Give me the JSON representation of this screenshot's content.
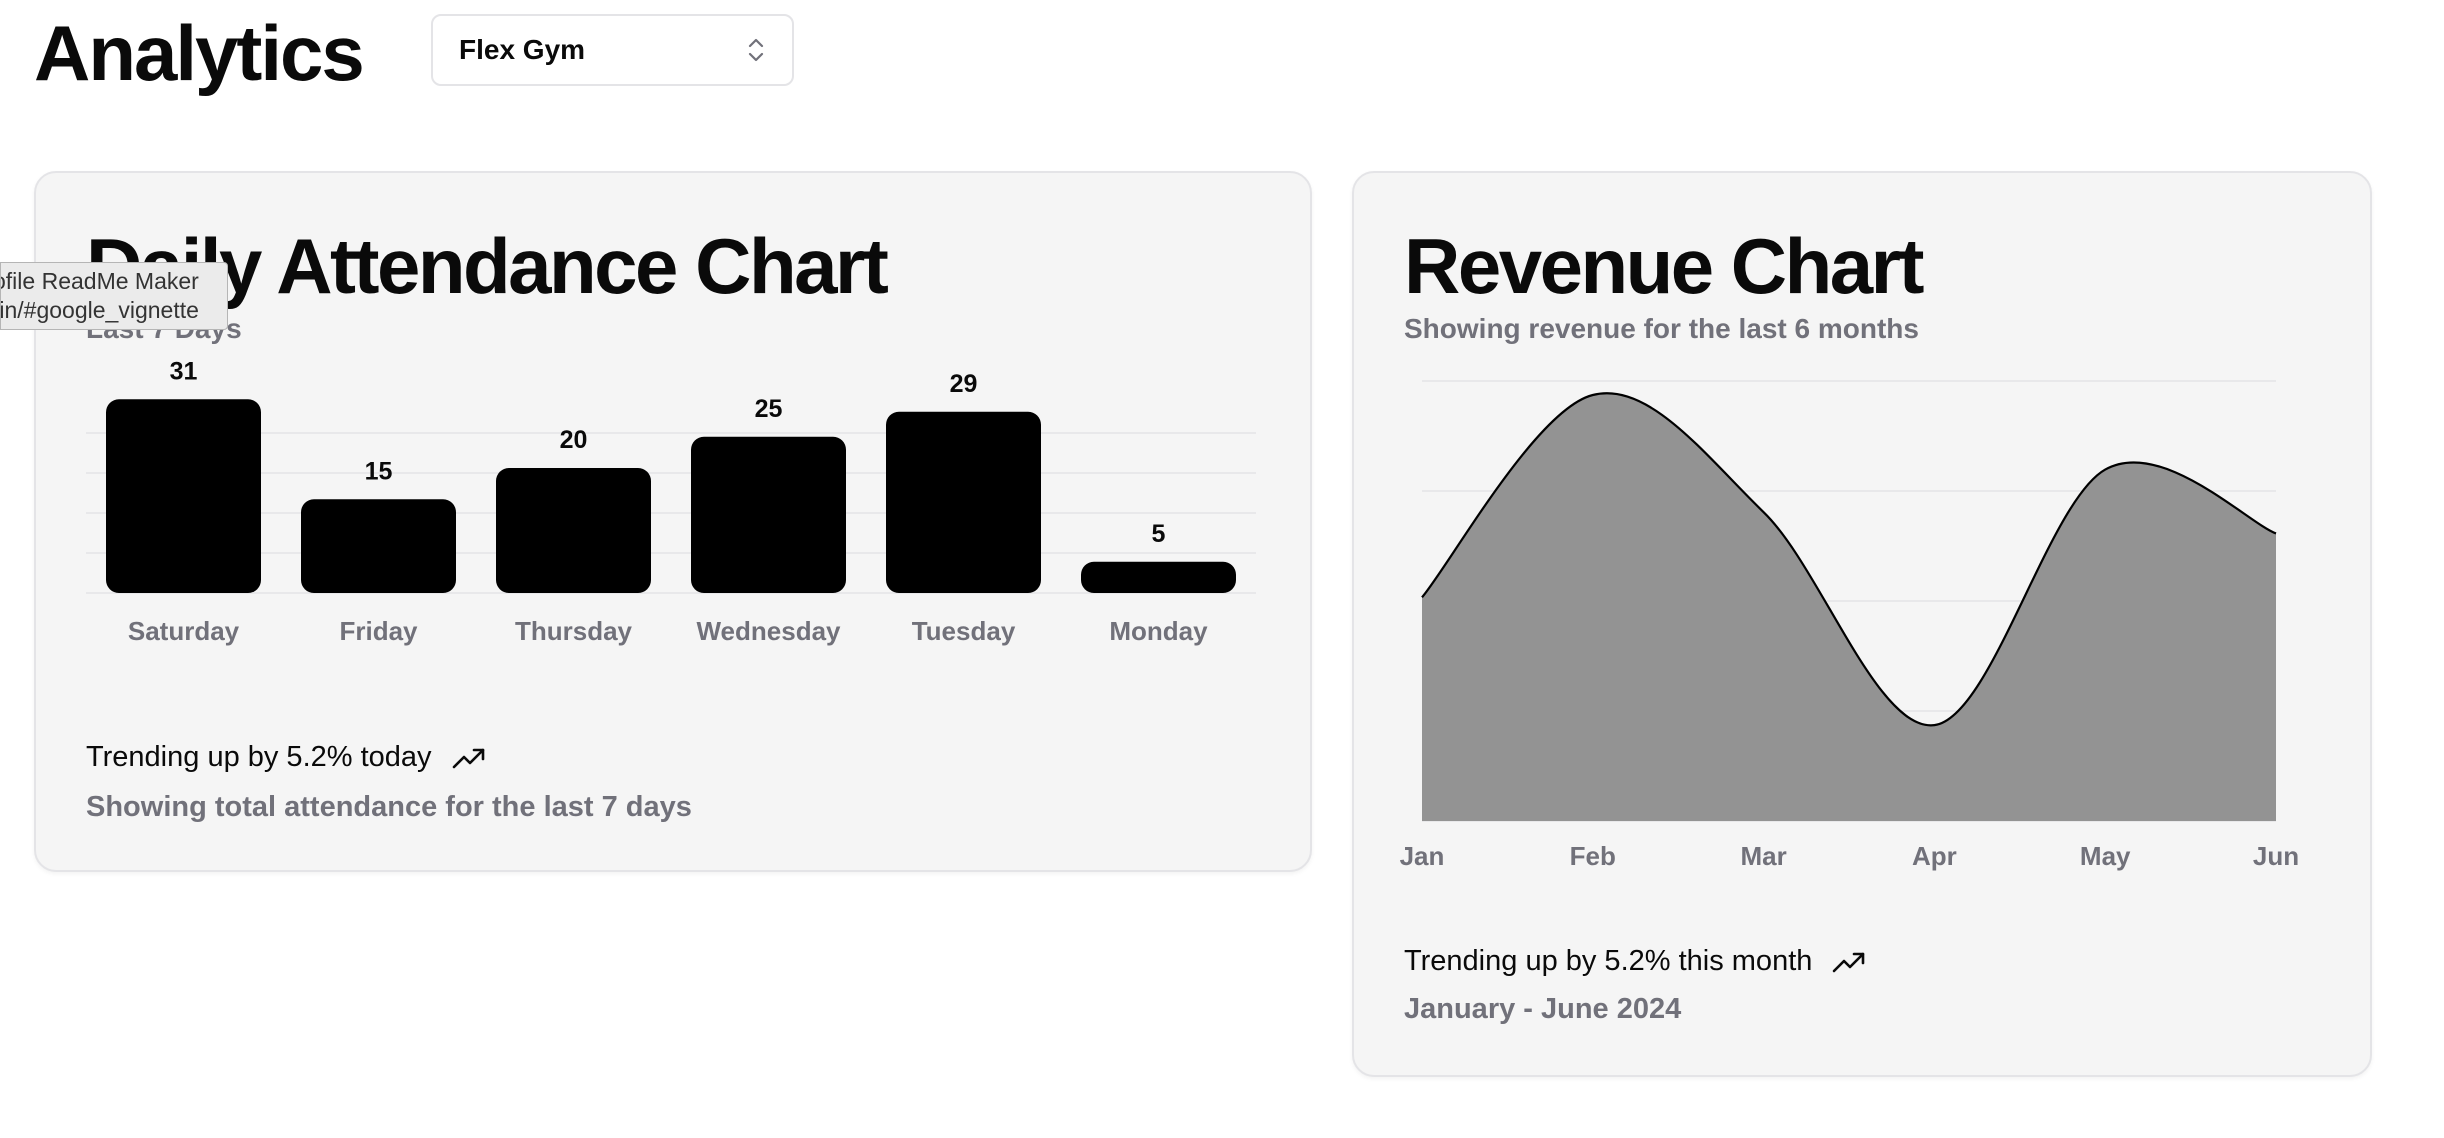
{
  "header": {
    "title": "Analytics",
    "gym_select": {
      "value": "Flex Gym"
    }
  },
  "tooltip": {
    "line1": "ofile ReadMe Maker",
    "line2": ".in/#google_vignette"
  },
  "attendance": {
    "title": "Daily Attendance Chart",
    "subtitle": "Last 7 Days",
    "trend_text": "Trending up by 5.2% today",
    "footer": "Showing total attendance for the last 7 days"
  },
  "revenue": {
    "title": "Revenue Chart",
    "subtitle": "Showing revenue for the last 6 months",
    "trend_text": "Trending up by 5.2% this month",
    "footer": "January - June 2024"
  },
  "colors": {
    "bar": "#000000",
    "area_fill": "#939393",
    "area_stroke": "#000000",
    "muted_text": "#71717a",
    "card_bg": "#f5f5f5",
    "grid": "#e4e4e7"
  },
  "icons": {
    "select": "chevron-up-down-icon",
    "trend": "trending-up-icon"
  },
  "chart_data": [
    {
      "type": "bar",
      "title": "Daily Attendance Chart",
      "subtitle": "Last 7 Days",
      "categories": [
        "Saturday",
        "Friday",
        "Thursday",
        "Wednesday",
        "Tuesday",
        "Monday"
      ],
      "values": [
        31,
        15,
        20,
        25,
        29,
        5
      ],
      "ylim": [
        0,
        32
      ],
      "grid": true,
      "data_labels": true
    },
    {
      "type": "area",
      "title": "Revenue Chart",
      "subtitle": "Showing revenue for the last 6 months",
      "categories": [
        "Jan",
        "Feb",
        "Mar",
        "Apr",
        "May",
        "Jun"
      ],
      "values": [
        42,
        80,
        58,
        18,
        66,
        54
      ],
      "ylim": [
        0,
        80
      ],
      "grid": true
    }
  ]
}
